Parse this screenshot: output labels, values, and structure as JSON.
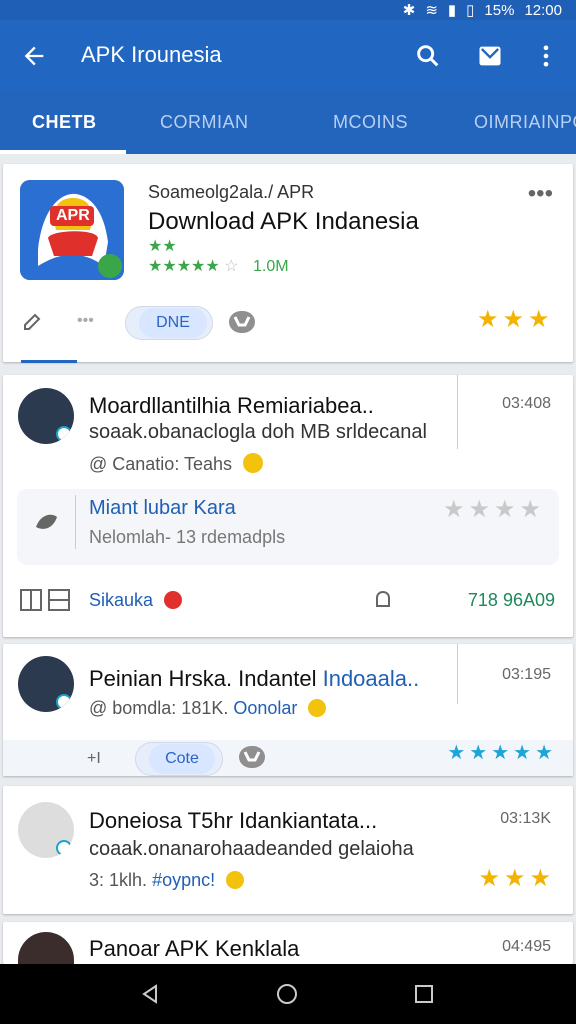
{
  "status": {
    "battery": "15%",
    "time": "12:00"
  },
  "appbar": {
    "title": "APK Irounesia",
    "icons": [
      "arrow-left-icon",
      "search-icon",
      "mail-icon",
      "more-vert-icon"
    ]
  },
  "tabs": [
    {
      "label": "CHETB",
      "active": true
    },
    {
      "label": "CORMIAN",
      "active": false
    },
    {
      "label": "MCOINS",
      "active": false
    },
    {
      "label": "OIMRIAINPO",
      "active": false
    }
  ],
  "featured": {
    "overline": "Soameolg2ala./ APR",
    "title": "Download APK Indanesia",
    "rating_text": "1.0M",
    "toggle_label": "DNE",
    "icon_text": "APR"
  },
  "post1": {
    "title": "Moardllantilhia Remiariabea..",
    "subtitle": "soaak.obanaclogla doh MB srldecanal",
    "meta": "@ Canatio: Teahs",
    "time": "03:408",
    "inner_title": "Miant lubar Kara",
    "inner_subtitle": "Nelomlah- 13 rdemadpls",
    "action_label": "Sikauka",
    "amount": "718 96A09"
  },
  "post2": {
    "title": "Peinian Hrska. Indantel",
    "title_link": "Indoaala..",
    "meta": "@ bomdla: 181K.",
    "meta_link": "Oonolar",
    "time": "03:195",
    "plus_label": "+I",
    "pill_label": "Cote"
  },
  "post3": {
    "title": "Doneiosa T5hr Idankiantata...",
    "subtitle": "coaak.onanarohaadeanded gelaioha",
    "meta_prefix": "3: 1klh.",
    "meta_link": "#oypnc!",
    "time": "03:13K"
  },
  "post4": {
    "title": "Panoar APK Kenklala",
    "time": "04:495"
  }
}
